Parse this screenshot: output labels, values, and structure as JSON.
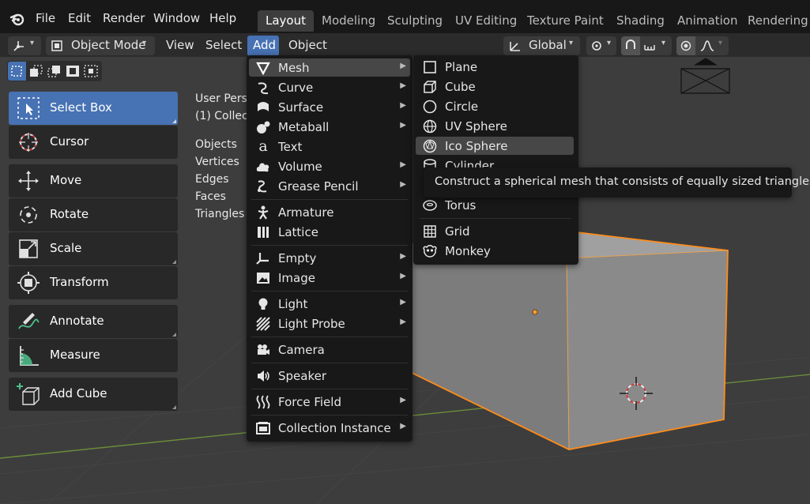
{
  "topbar": {
    "menus": [
      "File",
      "Edit",
      "Render",
      "Window",
      "Help"
    ],
    "workspaces": [
      "Layout",
      "Modeling",
      "Sculpting",
      "UV Editing",
      "Texture Paint",
      "Shading",
      "Animation",
      "Rendering"
    ],
    "active_workspace": "Layout"
  },
  "header": {
    "mode": "Object Mode",
    "menus": [
      "View",
      "Select",
      "Add",
      "Object"
    ],
    "active_menu": "Add",
    "transform_orientation": "Global"
  },
  "toolbar": {
    "tools": [
      "Select Box",
      "Cursor",
      "Move",
      "Rotate",
      "Scale",
      "Transform",
      "Annotate",
      "Measure",
      "Add Cube"
    ],
    "active_tool": "Select Box"
  },
  "viewport_info": {
    "view_name": "User Persp",
    "collection": "(1) Collec",
    "stats": [
      "Objects",
      "Vertices",
      "Edges",
      "Faces",
      "Triangles"
    ]
  },
  "add_menu": {
    "items": [
      {
        "label": "Mesh",
        "icon": "mesh-icon",
        "submenu": true
      },
      {
        "label": "Curve",
        "icon": "curve-icon",
        "submenu": true
      },
      {
        "label": "Surface",
        "icon": "surface-icon",
        "submenu": true
      },
      {
        "label": "Metaball",
        "icon": "metaball-icon",
        "submenu": true
      },
      {
        "label": "Text",
        "icon": "text-icon",
        "submenu": false
      },
      {
        "label": "Volume",
        "icon": "volume-icon",
        "submenu": true
      },
      {
        "label": "Grease Pencil",
        "icon": "grease-pencil-icon",
        "submenu": true
      },
      {
        "label": "Armature",
        "icon": "armature-icon",
        "submenu": false
      },
      {
        "label": "Lattice",
        "icon": "lattice-icon",
        "submenu": false
      },
      {
        "label": "Empty",
        "icon": "empty-icon",
        "submenu": true
      },
      {
        "label": "Image",
        "icon": "image-icon",
        "submenu": true
      },
      {
        "label": "Light",
        "icon": "light-icon",
        "submenu": true
      },
      {
        "label": "Light Probe",
        "icon": "light-probe-icon",
        "submenu": true
      },
      {
        "label": "Camera",
        "icon": "camera-icon",
        "submenu": false
      },
      {
        "label": "Speaker",
        "icon": "speaker-icon",
        "submenu": false
      },
      {
        "label": "Force Field",
        "icon": "force-field-icon",
        "submenu": true
      },
      {
        "label": "Collection Instance",
        "icon": "collection-instance-icon",
        "submenu": true
      }
    ],
    "highlighted": "Mesh"
  },
  "mesh_menu": {
    "items": [
      {
        "label": "Plane",
        "icon": "plane-icon"
      },
      {
        "label": "Cube",
        "icon": "cube-icon"
      },
      {
        "label": "Circle",
        "icon": "circle-icon"
      },
      {
        "label": "UV Sphere",
        "icon": "uv-sphere-icon"
      },
      {
        "label": "Ico Sphere",
        "icon": "ico-sphere-icon"
      },
      {
        "label": "Cylinder",
        "icon": "cylinder-icon"
      },
      {
        "label": "Torus",
        "icon": "torus-icon"
      },
      {
        "label": "Grid",
        "icon": "grid-icon"
      },
      {
        "label": "Monkey",
        "icon": "monkey-icon"
      }
    ],
    "highlighted": "Ico Sphere"
  },
  "tooltip": {
    "text": "Construct a spherical mesh that consists of equally sized triangles."
  },
  "colors": {
    "accent_blue": "#4772b3",
    "selection_orange": "#ff8c1a",
    "menu_bg": "#181818"
  }
}
